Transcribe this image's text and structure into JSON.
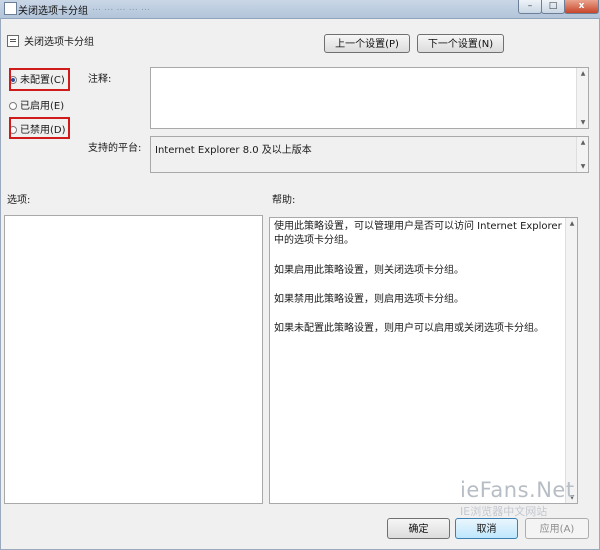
{
  "window": {
    "title": "关闭选项卡分组",
    "background_tabs": "...  ...  ...  ...  ...",
    "controls": {
      "minimize": "–",
      "maximize": "□",
      "close": "x"
    }
  },
  "header": {
    "policy_title": "关闭选项卡分组",
    "prev_button": "上一个设置(P)",
    "next_button": "下一个设置(N)"
  },
  "state_options": [
    {
      "label": "未配置(C)",
      "selected": true,
      "highlighted": true
    },
    {
      "label": "已启用(E)",
      "selected": false,
      "highlighted": false
    },
    {
      "label": "已禁用(D)",
      "selected": false,
      "highlighted": true
    }
  ],
  "comment": {
    "label": "注释:",
    "value": ""
  },
  "platform": {
    "label": "支持的平台:",
    "value": "Internet Explorer 8.0 及以上版本"
  },
  "options": {
    "label": "选项:"
  },
  "help": {
    "label": "帮助:",
    "paragraphs": [
      "使用此策略设置，可以管理用户是否可以访问 Internet Explorer 中的选项卡分组。",
      "如果启用此策略设置，则关闭选项卡分组。",
      "如果禁用此策略设置，则启用选项卡分组。",
      "如果未配置此策略设置，则用户可以启用或关闭选项卡分组。"
    ]
  },
  "watermark": {
    "main": "ieFans.Net",
    "sub": "IE浏览器中文网站"
  },
  "footer": {
    "ok": "确定",
    "cancel": "取消",
    "apply": "应用(A)"
  },
  "colors": {
    "highlight_box": "#d01b1b",
    "selected_radio": "#2a4e9a"
  }
}
